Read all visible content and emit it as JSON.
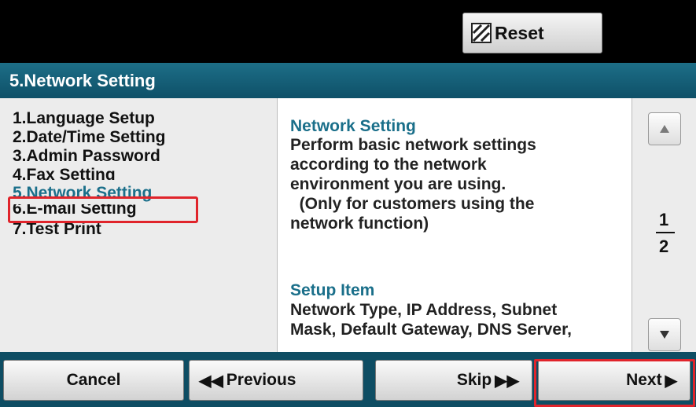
{
  "header": {
    "reset_label": "Reset",
    "reset_icon": "reset-icon"
  },
  "title": "5.Network Setting",
  "menu": {
    "items": [
      "1.Language Setup",
      "2.Date/Time Setting",
      "3.Admin Password",
      "4.Fax Setting",
      "5.Network Setting",
      "6.E-mail Setting",
      "7.Test Print"
    ],
    "selected_index": 4
  },
  "description": {
    "heading1": "Network Setting",
    "lines1": [
      "Perform basic network settings",
      "according to the network",
      "environment you are using.",
      "  (Only for customers using the",
      "network function)"
    ],
    "heading2": "Setup Item",
    "lines2": [
      "Network Type, IP Address, Subnet",
      "Mask, Default Gateway, DNS Server,"
    ]
  },
  "pager": {
    "current": "1",
    "total": "2",
    "up_icon": "triangle-up-icon",
    "down_icon": "triangle-down-icon"
  },
  "buttons": {
    "cancel": "Cancel",
    "previous": "Previous",
    "skip": "Skip",
    "next": "Next"
  },
  "colors": {
    "highlight": "#e0242b",
    "title_bar": "#0e5068",
    "heading": "#1a6f8a"
  }
}
